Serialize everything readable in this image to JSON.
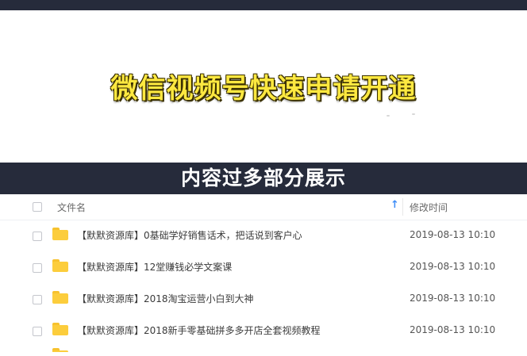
{
  "headline": "微信视频号快速申请开通",
  "section_banner": "内容过多部分展示",
  "file_list": {
    "columns": {
      "name": "文件名",
      "modified": "修改时间"
    },
    "sort_indicator": "↑",
    "rows": [
      {
        "name": "【默默资源库】0基础学好销售话术，把话说到客户心",
        "modified": "2019-08-13 10:10",
        "icon": "folder-icon"
      },
      {
        "name": "【默默资源库】12堂赚钱必学文案课",
        "modified": "2019-08-13 10:10",
        "icon": "folder-icon"
      },
      {
        "name": "【默默资源库】2018淘宝运营小白到大神",
        "modified": "2019-08-13 10:10",
        "icon": "folder-icon"
      },
      {
        "name": "【默默资源库】2018新手零基础拼多多开店全套视频教程",
        "modified": "2019-08-13 10:10",
        "icon": "folder-icon"
      }
    ]
  },
  "colors": {
    "banner_bg": "#262b3b",
    "headline_text": "#fde840",
    "folder": "#fccd3c",
    "sort_arrow": "#3e8df7"
  }
}
